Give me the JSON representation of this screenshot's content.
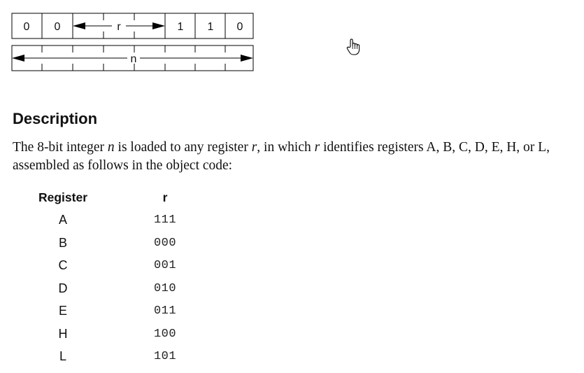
{
  "opcode": {
    "bits_fixed": [
      "0",
      "0",
      "1",
      "1",
      "0"
    ],
    "field_r_label": "r",
    "operand_label": "n"
  },
  "description": {
    "heading": "Description",
    "text_parts": [
      "The 8-bit integer ",
      "n",
      " is loaded to any register ",
      "r",
      ", in which ",
      "r",
      " identifies registers A, B, C, D, E, H, or L, assembled as follows in the object code:"
    ]
  },
  "register_table": {
    "headers": [
      "Register",
      "r"
    ],
    "rows": [
      {
        "register": "A",
        "r": "111"
      },
      {
        "register": "B",
        "r": "000"
      },
      {
        "register": "C",
        "r": "001"
      },
      {
        "register": "D",
        "r": "010"
      },
      {
        "register": "E",
        "r": "011"
      },
      {
        "register": "H",
        "r": "100"
      },
      {
        "register": "L",
        "r": "101"
      }
    ]
  },
  "icons": {
    "cursor": "hand-pointer-icon"
  }
}
